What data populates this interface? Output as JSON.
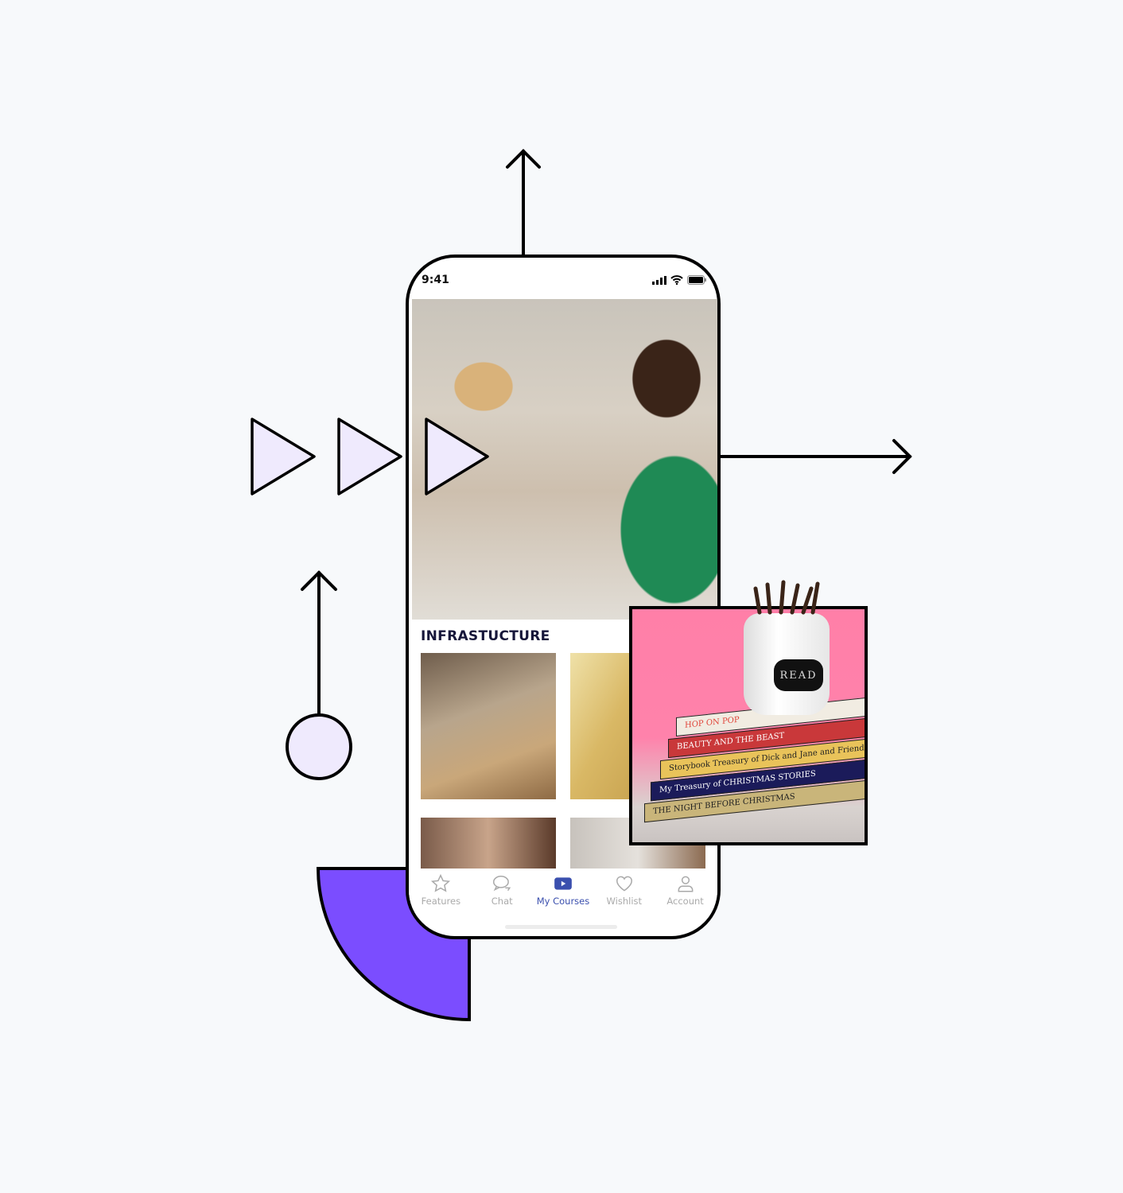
{
  "status_bar": {
    "time": "9:41"
  },
  "section": {
    "title": "INFRASTUCTURE"
  },
  "tabs": [
    {
      "label": "Features",
      "icon": "star-icon",
      "active": false
    },
    {
      "label": "Chat",
      "icon": "chat-bubbles-icon",
      "active": false
    },
    {
      "label": "My Courses",
      "icon": "play-video-icon",
      "active": true
    },
    {
      "label": "Wishlist",
      "icon": "heart-icon",
      "active": false
    },
    {
      "label": "Account",
      "icon": "user-icon",
      "active": false
    }
  ],
  "card": {
    "jar_label": "READ",
    "books": [
      "HOP ON POP",
      "BEAUTY AND THE BEAST",
      "Storybook Treasury of Dick and Jane and Friends",
      "My Treasury of CHRISTMAS STORIES",
      "THE NIGHT BEFORE CHRISTMAS"
    ]
  },
  "colors": {
    "accent": "#3a4fae",
    "purple": "#7b4dff",
    "triangle_fill": "#efeafd",
    "background": "#f7f9fb",
    "card_pink": "#ff7fa8"
  }
}
